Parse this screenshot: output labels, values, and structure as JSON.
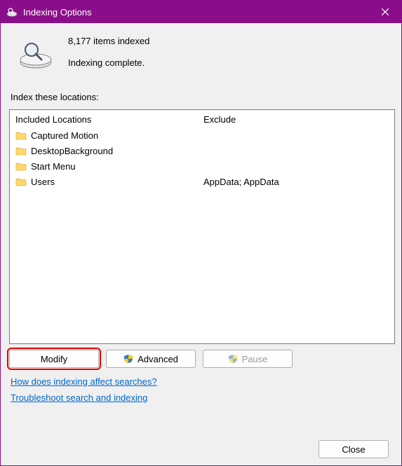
{
  "window": {
    "title": "Indexing Options"
  },
  "status": {
    "count_line": "8,177 items indexed",
    "state_line": "Indexing complete."
  },
  "locations_label": "Index these locations:",
  "columns": {
    "included": "Included Locations",
    "exclude": "Exclude"
  },
  "rows": [
    {
      "name": "Captured Motion",
      "exclude": ""
    },
    {
      "name": "DesktopBackground",
      "exclude": ""
    },
    {
      "name": "Start Menu",
      "exclude": ""
    },
    {
      "name": "Users",
      "exclude": "AppData; AppData"
    }
  ],
  "buttons": {
    "modify": "Modify",
    "advanced": "Advanced",
    "pause": "Pause",
    "close": "Close"
  },
  "links": {
    "how": "How does indexing affect searches?",
    "troubleshoot": "Troubleshoot search and indexing"
  }
}
